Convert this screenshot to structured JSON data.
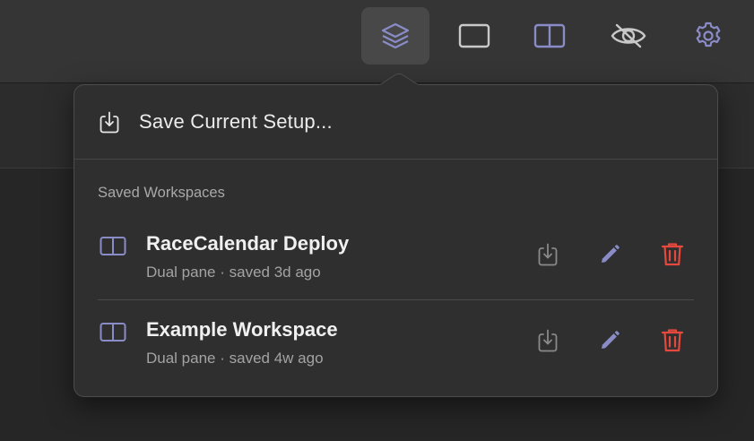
{
  "toolbar": {
    "buttons": [
      {
        "name": "layers-icon",
        "active": true
      },
      {
        "name": "single-pane-icon",
        "active": false
      },
      {
        "name": "dual-pane-icon",
        "active": false
      },
      {
        "name": "eye-slash-icon",
        "active": false
      },
      {
        "name": "gear-icon",
        "active": false
      }
    ]
  },
  "popover": {
    "save_label": "Save Current Setup...",
    "section_title": "Saved Workspaces",
    "workspaces": [
      {
        "name": "RaceCalendar Deploy",
        "meta": "Dual pane · saved 3d ago"
      },
      {
        "name": "Example Workspace",
        "meta": "Dual pane · saved 4w ago"
      }
    ]
  },
  "colors": {
    "accent": "#8a8cc8",
    "delete": "#e5483d",
    "load": "#8a8a8a"
  }
}
